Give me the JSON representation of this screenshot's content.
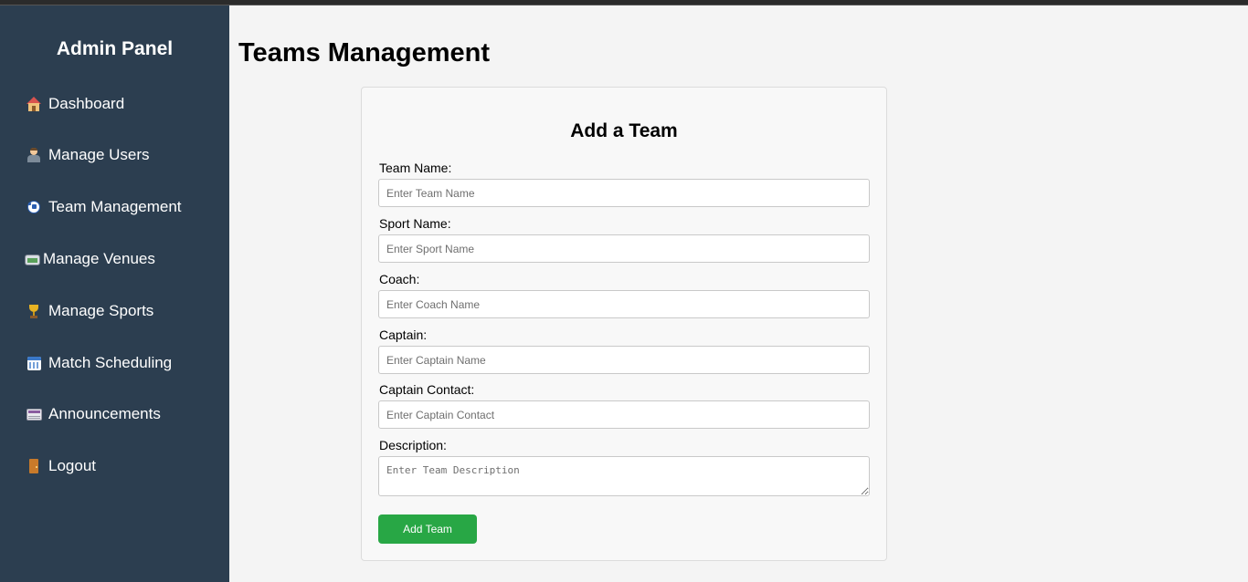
{
  "sidebar": {
    "title": "Admin Panel",
    "items": [
      {
        "label": "Dashboard",
        "icon": "house-icon"
      },
      {
        "label": "Manage Users",
        "icon": "user-icon"
      },
      {
        "label": "Team Management",
        "icon": "soccer-ball-icon"
      },
      {
        "label": "Manage Venues",
        "icon": "stadium-icon"
      },
      {
        "label": "Manage Sports",
        "icon": "trophy-icon"
      },
      {
        "label": "Match Scheduling",
        "icon": "calendar-icon"
      },
      {
        "label": "Announcements",
        "icon": "newspaper-icon"
      },
      {
        "label": "Logout",
        "icon": "door-icon"
      }
    ]
  },
  "main": {
    "page_title": "Teams Management",
    "form": {
      "title": "Add a Team",
      "fields": [
        {
          "label": "Team Name:",
          "placeholder": "Enter Team Name",
          "value": ""
        },
        {
          "label": "Sport Name:",
          "placeholder": "Enter Sport Name",
          "value": ""
        },
        {
          "label": "Coach:",
          "placeholder": "Enter Coach Name",
          "value": ""
        },
        {
          "label": "Captain:",
          "placeholder": "Enter Captain Name",
          "value": ""
        },
        {
          "label": "Captain Contact:",
          "placeholder": "Enter Captain Contact",
          "value": ""
        },
        {
          "label": "Description:",
          "placeholder": "Enter Team Description",
          "value": ""
        }
      ],
      "submit_label": "Add Team"
    }
  },
  "colors": {
    "sidebar_bg": "#2c3e50",
    "page_bg": "#f4f4f4",
    "submit_button": "#28a745"
  }
}
